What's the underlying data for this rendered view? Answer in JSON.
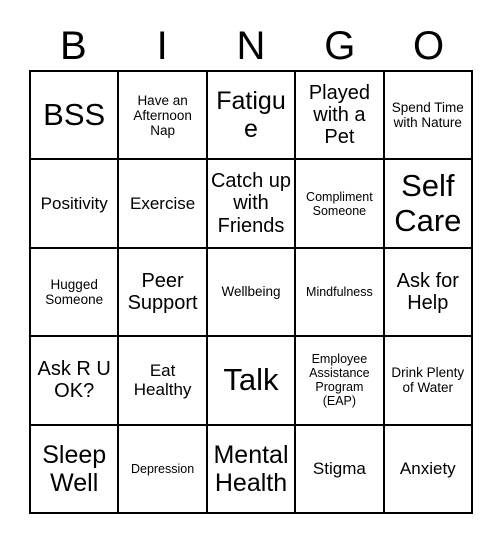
{
  "card": {
    "header_letters": [
      "B",
      "I",
      "N",
      "G",
      "O"
    ],
    "grid_columns": 5,
    "grid_rows": 5,
    "border_color": "#000000",
    "background_color": "#ffffff",
    "text_color": "#000000",
    "rows": [
      [
        {
          "label": "BSS",
          "size": "sz-xl"
        },
        {
          "label": "Have an Afternoon Nap",
          "size": "sz-xs"
        },
        {
          "label": "Fatigue",
          "size": "sz-lg"
        },
        {
          "label": "Played with a Pet",
          "size": "sz-md"
        },
        {
          "label": "Spend Time with Nature",
          "size": "sz-xs"
        }
      ],
      [
        {
          "label": "Positivity",
          "size": "sz-sm"
        },
        {
          "label": "Exercise",
          "size": "sz-sm"
        },
        {
          "label": "Catch up with Friends",
          "size": "sz-md"
        },
        {
          "label": "Compliment Someone",
          "size": "sz-xxs"
        },
        {
          "label": "Self Care",
          "size": "sz-xl"
        }
      ],
      [
        {
          "label": "Hugged Someone",
          "size": "sz-xs"
        },
        {
          "label": "Peer Support",
          "size": "sz-md"
        },
        {
          "label": "Wellbeing",
          "size": "sz-xs"
        },
        {
          "label": "Mindfulness",
          "size": "sz-xxs"
        },
        {
          "label": "Ask for Help",
          "size": "sz-md"
        }
      ],
      [
        {
          "label": "Ask R U OK?",
          "size": "sz-md"
        },
        {
          "label": "Eat Healthy",
          "size": "sz-sm"
        },
        {
          "label": "Talk",
          "size": "sz-xl"
        },
        {
          "label": "Employee Assistance Program (EAP)",
          "size": "sz-xxs"
        },
        {
          "label": "Drink Plenty of Water",
          "size": "sz-xs"
        }
      ],
      [
        {
          "label": "Sleep Well",
          "size": "sz-lg"
        },
        {
          "label": "Depression",
          "size": "sz-xxs"
        },
        {
          "label": "Mental Health",
          "size": "sz-lg"
        },
        {
          "label": "Stigma",
          "size": "sz-sm"
        },
        {
          "label": "Anxiety",
          "size": "sz-sm"
        }
      ]
    ]
  }
}
